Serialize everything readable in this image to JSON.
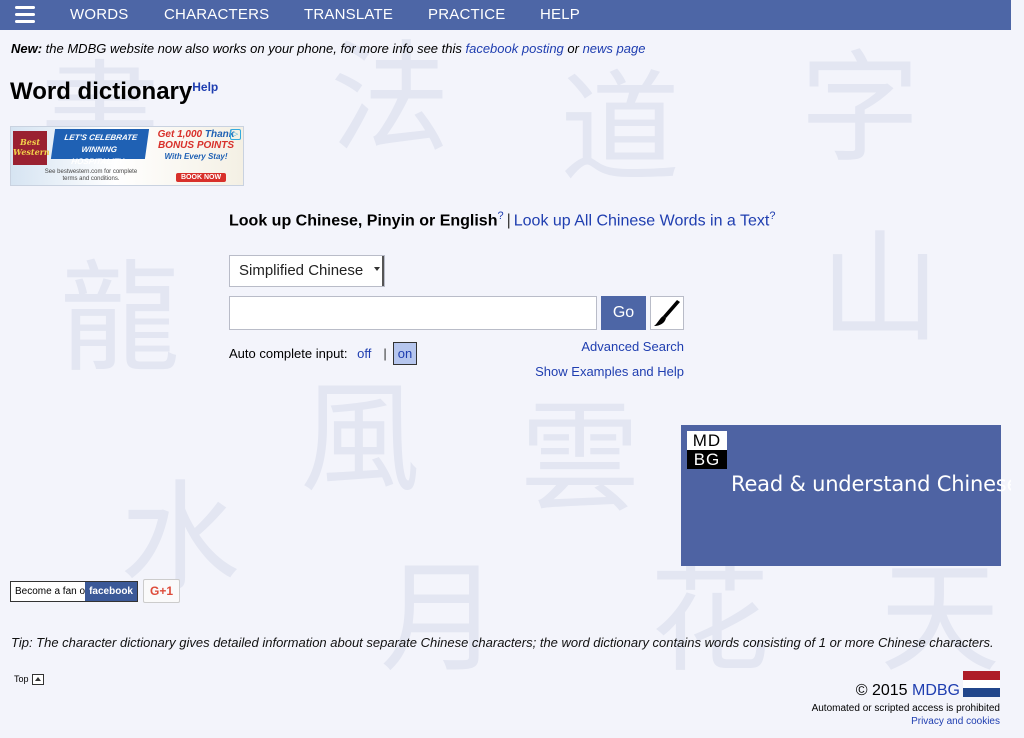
{
  "nav": {
    "items": [
      "WORDS",
      "CHARACTERS",
      "TRANSLATE",
      "PRACTICE",
      "HELP"
    ]
  },
  "news": {
    "label": "New:",
    "text": " the MDBG website now also works on your phone, for more info see this ",
    "link1": "facebook posting",
    "or": " or ",
    "link2": "news page"
  },
  "page": {
    "title": "Word dictionary",
    "help": "Help"
  },
  "ad": {
    "logo": "Best Western",
    "banner": "LET'S CELEBRATE WINNING HOSPITALITY",
    "get": "Get 1,000",
    "thanks": "Thank",
    "bonus": "BONUS POINTS",
    "stay": "With Every Stay!",
    "fine": "See bestwestern.com for complete terms and conditions.",
    "book": "BOOK NOW"
  },
  "lookup": {
    "label": "Look up Chinese, Pinyin or English",
    "q1": "?",
    "sep": "|",
    "all_link": "Look up All Chinese Words in a Text",
    "q2": "?"
  },
  "search": {
    "script_selected": "Simplified Chinese",
    "input_value": "",
    "go_label": "Go"
  },
  "autocomplete": {
    "label": "Auto complete input:",
    "off": "off",
    "pipe": "|",
    "on": "on"
  },
  "links": {
    "advanced": "Advanced Search",
    "examples": "Show Examples and Help"
  },
  "promo": {
    "logo_top": "MD",
    "logo_bottom": "BG",
    "tagline": "Read & understand Chinese"
  },
  "social": {
    "fb_text": "Become a fan on",
    "fb_brand": "facebook",
    "gplus": "G+1"
  },
  "tip": "Tip: The character dictionary gives detailed information about separate Chinese characters; the word dictionary contains words consisting of 1 or more Chinese characters.",
  "footer": {
    "top": "Top",
    "copyright": "© 2015 ",
    "brand": "MDBG",
    "automated": "Automated or scripted access is prohibited",
    "privacy": "Privacy and cookies"
  },
  "colors": {
    "nav_bg": "#4d66a6",
    "link": "#1f3eb0",
    "flag": [
      "#ae1c28",
      "#ffffff",
      "#21468b"
    ]
  },
  "icons": [
    "hamburger-menu-icon",
    "calligraphy-brush-icon",
    "scroll-top-icon",
    "netherlands-flag-icon",
    "adchoices-icon"
  ]
}
